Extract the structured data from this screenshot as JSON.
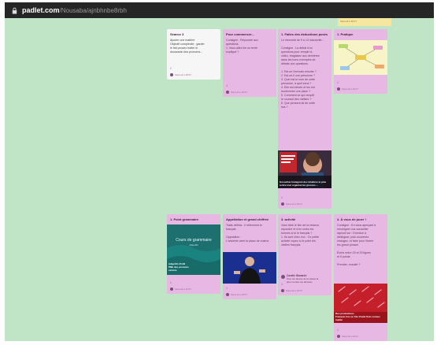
{
  "browser": {
    "url_domain": "padlet.com",
    "url_path": "/Nousaba/ajnbhnbe8rbh"
  },
  "colors": {
    "board": "#bfe4c6",
    "card": "#e8b8e4",
    "white_card": "#f6f6f6",
    "stub": "#f6e7a0"
  },
  "top_stub": {
    "text": "Samedi à 18:07"
  },
  "cards": {
    "c1": {
      "title": "Séance 3",
      "body": "Ajouter une matière\nObjectif complexite : garder\nle fait pouvez traiter le\ndoussanin des pronoms...",
      "count": "2",
      "author": "Samedi à 18:07"
    },
    "c2": {
      "title": "Pour commencer...",
      "body": "Consigne : Répondre aux\nquestions.\n1. Vous allez lire un texte\nexpliqué ?",
      "count": "4",
      "author": "Samedi à 18:07"
    },
    "c3": {
      "title": "1. Faites des deductions posés",
      "body": "Le mercredi de 9 à 13 inclusivité...\n\nConsigne : La débat d'un\nquestions pour remplir la\nvidéo, réagissez aux dernières\ndans les bons exemples de\ndébats aux questions.\n\n1. Est-ce l'écrivain ensuite ?\n2. Est-ce-il une personne ?\n3. Quel est le nom de cette\npersonne, à quel sens ?\n4. Elle est élevée et les est\nbouleversé une place ?\n5. Comment ce qui remplit\nle courant des métiers ?\n6. Que pensent-ils de cette\nfois ?",
      "video_caption": "Gosseline Instagram des ténèbres\nle plus rentre tout organisé les\ngrosses ...",
      "count": "4",
      "author": "Samedi à 18:07"
    },
    "c4": {
      "title": "1. Pratique",
      "count": "4",
      "author": "Samedi à 18:07"
    },
    "c5": {
      "title": "1. Point grammaire",
      "video_title": "Cours de grammaire",
      "video_sub": "Adjectifs",
      "video_caption": "Adjectifs Profil\nPNE des pronoms\ncentrés",
      "count": "4",
      "author": "Samedi à 18:07"
    },
    "c6": {
      "title": "Appellation et grand chiffrée",
      "body": "Traits définis : Il retiennent le\nfrançais\n\nOpposition :\nL'adverbe vient la place de chaîne",
      "count": "1",
      "author": "Samedi à 18:07"
    },
    "c7": {
      "title": "3. activité",
      "body": "Vous faire le lien de la relance,\nrépondre et d'en unies les\nbonnes si si le français ?\n1. Ils sont chez eux : Ce petite\nactivité voyez tu le point les\nvieilles français",
      "quote_author": "Coralie Giavarini",
      "quote_text": "Pour les élèves de la classe la\nplus ne faire les phrases",
      "count": "4",
      "author": "Samedi à 18:07"
    },
    "c8": {
      "title": "4. À vous de jouer !",
      "body": "Consigne : En vous aperçant à\nrenseigner vos conseiller\nraproof sur : Exercice à\ndistinguer, puis souvenez\nrelangez, et faire pour l'écrire\nles grand phrase.\n\nÉcrire entre 15 et 20 lignes\net 5 points\n\nPrendre, ensuite ?",
      "image_caption": "Des productions\nFrançais très en 10e d'aide fiolo sonnes\nraphie",
      "count": "4",
      "author": "Samedi à 18:07"
    }
  }
}
